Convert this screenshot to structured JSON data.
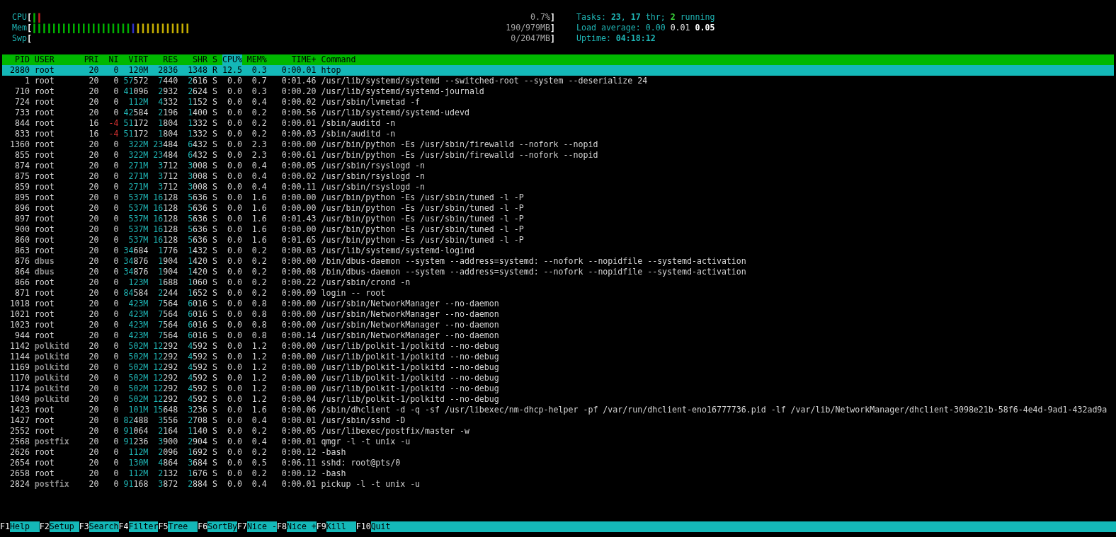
{
  "meters": [
    {
      "label": "CPU",
      "open": "[",
      "segments": [
        {
          "text": "|",
          "color": "#00b000"
        },
        {
          "text": "|",
          "color": "#c02020"
        }
      ],
      "value": "0.7%",
      "close": "]"
    },
    {
      "label": "Mem",
      "open": "[",
      "segments": [
        {
          "text": "||||||||||||||||||||",
          "color": "#00b000"
        },
        {
          "text": "|",
          "color": "#3030c8"
        },
        {
          "text": "|||||||||||",
          "color": "#c8b000"
        }
      ],
      "value": "190/979MB",
      "close": "]"
    },
    {
      "label": "Swp",
      "open": "[",
      "value": "0/2047MB",
      "close": "]"
    }
  ],
  "stats": [
    [
      {
        "text": "Tasks: ",
        "kind": "label"
      },
      {
        "text": "23",
        "kind": "value"
      },
      {
        "text": ", ",
        "kind": "label"
      },
      {
        "text": "17",
        "kind": "value"
      },
      {
        "text": " thr; ",
        "kind": "label"
      },
      {
        "text": "2",
        "kind": "running"
      },
      {
        "text": " running",
        "kind": "label"
      }
    ],
    [
      {
        "text": "Load average: ",
        "kind": "label"
      },
      {
        "text": "0.00",
        "kind": "plain"
      },
      {
        "text": "0.01",
        "kind": "mid"
      },
      {
        "text": "0.05",
        "kind": "strong"
      }
    ],
    [
      {
        "text": "Uptime: ",
        "kind": "label"
      },
      {
        "text": "04:18:12",
        "kind": "value"
      }
    ]
  ],
  "table": {
    "columns": [
      {
        "label": "PID",
        "sorted": false
      },
      {
        "label": "USER",
        "sorted": false
      },
      {
        "label": "PRI",
        "sorted": false
      },
      {
        "label": "NI",
        "sorted": false
      },
      {
        "label": "VIRT",
        "sorted": false
      },
      {
        "label": "RES",
        "sorted": false
      },
      {
        "label": "SHR",
        "sorted": false
      },
      {
        "label": "S",
        "sorted": false
      },
      {
        "label": "CPU%",
        "sorted": true
      },
      {
        "label": "MEM%",
        "sorted": false
      },
      {
        "label": "TIME+",
        "sorted": false
      },
      {
        "label": "Command",
        "sorted": false
      }
    ],
    "rows": [
      {
        "pid": "2880",
        "user": "root",
        "dim": false,
        "pri": "20",
        "ni": "0",
        "virt": "120M",
        "res": "2836",
        "shr": "1348",
        "s": "R",
        "cpu": "12.5",
        "mem": "0.3",
        "time": "0:00.01",
        "command": "htop",
        "selected": true
      },
      {
        "pid": "1",
        "user": "root",
        "dim": false,
        "pri": "20",
        "ni": "0",
        "virt": "57572",
        "res": "7440",
        "shr": "2616",
        "s": "S",
        "cpu": "0.0",
        "mem": "0.7",
        "time": "0:01.46",
        "command": "/usr/lib/systemd/systemd --switched-root --system --deserialize 24",
        "selected": false
      },
      {
        "pid": "710",
        "user": "root",
        "dim": false,
        "pri": "20",
        "ni": "0",
        "virt": "41096",
        "res": "2932",
        "shr": "2624",
        "s": "S",
        "cpu": "0.0",
        "mem": "0.3",
        "time": "0:00.20",
        "command": "/usr/lib/systemd/systemd-journald",
        "selected": false
      },
      {
        "pid": "724",
        "user": "root",
        "dim": false,
        "pri": "20",
        "ni": "0",
        "virt": "112M",
        "res": "4332",
        "shr": "1152",
        "s": "S",
        "cpu": "0.0",
        "mem": "0.4",
        "time": "0:00.02",
        "command": "/usr/sbin/lvmetad -f",
        "selected": false
      },
      {
        "pid": "733",
        "user": "root",
        "dim": false,
        "pri": "20",
        "ni": "0",
        "virt": "42584",
        "res": "2196",
        "shr": "1400",
        "s": "S",
        "cpu": "0.0",
        "mem": "0.2",
        "time": "0:00.56",
        "command": "/usr/lib/systemd/systemd-udevd",
        "selected": false
      },
      {
        "pid": "844",
        "user": "root",
        "dim": false,
        "pri": "16",
        "ni": "-4",
        "virt": "51172",
        "res": "1804",
        "shr": "1332",
        "s": "S",
        "cpu": "0.0",
        "mem": "0.2",
        "time": "0:00.01",
        "command": "/sbin/auditd -n",
        "selected": false
      },
      {
        "pid": "833",
        "user": "root",
        "dim": false,
        "pri": "16",
        "ni": "-4",
        "virt": "51172",
        "res": "1804",
        "shr": "1332",
        "s": "S",
        "cpu": "0.0",
        "mem": "0.2",
        "time": "0:00.03",
        "command": "/sbin/auditd -n",
        "selected": false
      },
      {
        "pid": "1360",
        "user": "root",
        "dim": false,
        "pri": "20",
        "ni": "0",
        "virt": "322M",
        "res": "23484",
        "shr": "6432",
        "s": "S",
        "cpu": "0.0",
        "mem": "2.3",
        "time": "0:00.00",
        "command": "/usr/bin/python -Es /usr/sbin/firewalld --nofork --nopid",
        "selected": false
      },
      {
        "pid": "855",
        "user": "root",
        "dim": false,
        "pri": "20",
        "ni": "0",
        "virt": "322M",
        "res": "23484",
        "shr": "6432",
        "s": "S",
        "cpu": "0.0",
        "mem": "2.3",
        "time": "0:00.61",
        "command": "/usr/bin/python -Es /usr/sbin/firewalld --nofork --nopid",
        "selected": false
      },
      {
        "pid": "874",
        "user": "root",
        "dim": false,
        "pri": "20",
        "ni": "0",
        "virt": "271M",
        "res": "3712",
        "shr": "3008",
        "s": "S",
        "cpu": "0.0",
        "mem": "0.4",
        "time": "0:00.05",
        "command": "/usr/sbin/rsyslogd -n",
        "selected": false
      },
      {
        "pid": "875",
        "user": "root",
        "dim": false,
        "pri": "20",
        "ni": "0",
        "virt": "271M",
        "res": "3712",
        "shr": "3008",
        "s": "S",
        "cpu": "0.0",
        "mem": "0.4",
        "time": "0:00.02",
        "command": "/usr/sbin/rsyslogd -n",
        "selected": false
      },
      {
        "pid": "859",
        "user": "root",
        "dim": false,
        "pri": "20",
        "ni": "0",
        "virt": "271M",
        "res": "3712",
        "shr": "3008",
        "s": "S",
        "cpu": "0.0",
        "mem": "0.4",
        "time": "0:00.11",
        "command": "/usr/sbin/rsyslogd -n",
        "selected": false
      },
      {
        "pid": "895",
        "user": "root",
        "dim": false,
        "pri": "20",
        "ni": "0",
        "virt": "537M",
        "res": "16128",
        "shr": "5636",
        "s": "S",
        "cpu": "0.0",
        "mem": "1.6",
        "time": "0:00.00",
        "command": "/usr/bin/python -Es /usr/sbin/tuned -l -P",
        "selected": false
      },
      {
        "pid": "896",
        "user": "root",
        "dim": false,
        "pri": "20",
        "ni": "0",
        "virt": "537M",
        "res": "16128",
        "shr": "5636",
        "s": "S",
        "cpu": "0.0",
        "mem": "1.6",
        "time": "0:00.00",
        "command": "/usr/bin/python -Es /usr/sbin/tuned -l -P",
        "selected": false
      },
      {
        "pid": "897",
        "user": "root",
        "dim": false,
        "pri": "20",
        "ni": "0",
        "virt": "537M",
        "res": "16128",
        "shr": "5636",
        "s": "S",
        "cpu": "0.0",
        "mem": "1.6",
        "time": "0:01.43",
        "command": "/usr/bin/python -Es /usr/sbin/tuned -l -P",
        "selected": false
      },
      {
        "pid": "900",
        "user": "root",
        "dim": false,
        "pri": "20",
        "ni": "0",
        "virt": "537M",
        "res": "16128",
        "shr": "5636",
        "s": "S",
        "cpu": "0.0",
        "mem": "1.6",
        "time": "0:00.00",
        "command": "/usr/bin/python -Es /usr/sbin/tuned -l -P",
        "selected": false
      },
      {
        "pid": "860",
        "user": "root",
        "dim": false,
        "pri": "20",
        "ni": "0",
        "virt": "537M",
        "res": "16128",
        "shr": "5636",
        "s": "S",
        "cpu": "0.0",
        "mem": "1.6",
        "time": "0:01.65",
        "command": "/usr/bin/python -Es /usr/sbin/tuned -l -P",
        "selected": false
      },
      {
        "pid": "863",
        "user": "root",
        "dim": false,
        "pri": "20",
        "ni": "0",
        "virt": "34684",
        "res": "1776",
        "shr": "1432",
        "s": "S",
        "cpu": "0.0",
        "mem": "0.2",
        "time": "0:00.03",
        "command": "/usr/lib/systemd/systemd-logind",
        "selected": false
      },
      {
        "pid": "876",
        "user": "dbus",
        "dim": true,
        "pri": "20",
        "ni": "0",
        "virt": "34876",
        "res": "1904",
        "shr": "1420",
        "s": "S",
        "cpu": "0.0",
        "mem": "0.2",
        "time": "0:00.00",
        "command": "/bin/dbus-daemon --system --address=systemd: --nofork --nopidfile --systemd-activation",
        "selected": false
      },
      {
        "pid": "864",
        "user": "dbus",
        "dim": true,
        "pri": "20",
        "ni": "0",
        "virt": "34876",
        "res": "1904",
        "shr": "1420",
        "s": "S",
        "cpu": "0.0",
        "mem": "0.2",
        "time": "0:00.08",
        "command": "/bin/dbus-daemon --system --address=systemd: --nofork --nopidfile --systemd-activation",
        "selected": false
      },
      {
        "pid": "866",
        "user": "root",
        "dim": false,
        "pri": "20",
        "ni": "0",
        "virt": "123M",
        "res": "1688",
        "shr": "1060",
        "s": "S",
        "cpu": "0.0",
        "mem": "0.2",
        "time": "0:00.22",
        "command": "/usr/sbin/crond -n",
        "selected": false
      },
      {
        "pid": "871",
        "user": "root",
        "dim": false,
        "pri": "20",
        "ni": "0",
        "virt": "84584",
        "res": "2244",
        "shr": "1652",
        "s": "S",
        "cpu": "0.0",
        "mem": "0.2",
        "time": "0:00.09",
        "command": "login -- root",
        "selected": false
      },
      {
        "pid": "1018",
        "user": "root",
        "dim": false,
        "pri": "20",
        "ni": "0",
        "virt": "423M",
        "res": "7564",
        "shr": "6016",
        "s": "S",
        "cpu": "0.0",
        "mem": "0.8",
        "time": "0:00.00",
        "command": "/usr/sbin/NetworkManager --no-daemon",
        "selected": false
      },
      {
        "pid": "1021",
        "user": "root",
        "dim": false,
        "pri": "20",
        "ni": "0",
        "virt": "423M",
        "res": "7564",
        "shr": "6016",
        "s": "S",
        "cpu": "0.0",
        "mem": "0.8",
        "time": "0:00.00",
        "command": "/usr/sbin/NetworkManager --no-daemon",
        "selected": false
      },
      {
        "pid": "1023",
        "user": "root",
        "dim": false,
        "pri": "20",
        "ni": "0",
        "virt": "423M",
        "res": "7564",
        "shr": "6016",
        "s": "S",
        "cpu": "0.0",
        "mem": "0.8",
        "time": "0:00.00",
        "command": "/usr/sbin/NetworkManager --no-daemon",
        "selected": false
      },
      {
        "pid": "944",
        "user": "root",
        "dim": false,
        "pri": "20",
        "ni": "0",
        "virt": "423M",
        "res": "7564",
        "shr": "6016",
        "s": "S",
        "cpu": "0.0",
        "mem": "0.8",
        "time": "0:00.14",
        "command": "/usr/sbin/NetworkManager --no-daemon",
        "selected": false
      },
      {
        "pid": "1142",
        "user": "polkitd",
        "dim": true,
        "pri": "20",
        "ni": "0",
        "virt": "502M",
        "res": "12292",
        "shr": "4592",
        "s": "S",
        "cpu": "0.0",
        "mem": "1.2",
        "time": "0:00.00",
        "command": "/usr/lib/polkit-1/polkitd --no-debug",
        "selected": false
      },
      {
        "pid": "1144",
        "user": "polkitd",
        "dim": true,
        "pri": "20",
        "ni": "0",
        "virt": "502M",
        "res": "12292",
        "shr": "4592",
        "s": "S",
        "cpu": "0.0",
        "mem": "1.2",
        "time": "0:00.00",
        "command": "/usr/lib/polkit-1/polkitd --no-debug",
        "selected": false
      },
      {
        "pid": "1169",
        "user": "polkitd",
        "dim": true,
        "pri": "20",
        "ni": "0",
        "virt": "502M",
        "res": "12292",
        "shr": "4592",
        "s": "S",
        "cpu": "0.0",
        "mem": "1.2",
        "time": "0:00.00",
        "command": "/usr/lib/polkit-1/polkitd --no-debug",
        "selected": false
      },
      {
        "pid": "1170",
        "user": "polkitd",
        "dim": true,
        "pri": "20",
        "ni": "0",
        "virt": "502M",
        "res": "12292",
        "shr": "4592",
        "s": "S",
        "cpu": "0.0",
        "mem": "1.2",
        "time": "0:00.00",
        "command": "/usr/lib/polkit-1/polkitd --no-debug",
        "selected": false
      },
      {
        "pid": "1174",
        "user": "polkitd",
        "dim": true,
        "pri": "20",
        "ni": "0",
        "virt": "502M",
        "res": "12292",
        "shr": "4592",
        "s": "S",
        "cpu": "0.0",
        "mem": "1.2",
        "time": "0:00.00",
        "command": "/usr/lib/polkit-1/polkitd --no-debug",
        "selected": false
      },
      {
        "pid": "1049",
        "user": "polkitd",
        "dim": true,
        "pri": "20",
        "ni": "0",
        "virt": "502M",
        "res": "12292",
        "shr": "4592",
        "s": "S",
        "cpu": "0.0",
        "mem": "1.2",
        "time": "0:00.04",
        "command": "/usr/lib/polkit-1/polkitd --no-debug",
        "selected": false
      },
      {
        "pid": "1423",
        "user": "root",
        "dim": false,
        "pri": "20",
        "ni": "0",
        "virt": "101M",
        "res": "15648",
        "shr": "3236",
        "s": "S",
        "cpu": "0.0",
        "mem": "1.6",
        "time": "0:00.06",
        "command": "/sbin/dhclient -d -q -sf /usr/libexec/nm-dhcp-helper -pf /var/run/dhclient-eno16777736.pid -lf /var/lib/NetworkManager/dhclient-3098e21b-58f6-4e4d-9ad1-432ad9a",
        "selected": false
      },
      {
        "pid": "1427",
        "user": "root",
        "dim": false,
        "pri": "20",
        "ni": "0",
        "virt": "82488",
        "res": "3556",
        "shr": "2708",
        "s": "S",
        "cpu": "0.0",
        "mem": "0.4",
        "time": "0:00.01",
        "command": "/usr/sbin/sshd -D",
        "selected": false
      },
      {
        "pid": "2552",
        "user": "root",
        "dim": false,
        "pri": "20",
        "ni": "0",
        "virt": "91064",
        "res": "2164",
        "shr": "1140",
        "s": "S",
        "cpu": "0.0",
        "mem": "0.2",
        "time": "0:00.05",
        "command": "/usr/libexec/postfix/master -w",
        "selected": false
      },
      {
        "pid": "2568",
        "user": "postfix",
        "dim": true,
        "pri": "20",
        "ni": "0",
        "virt": "91236",
        "res": "3900",
        "shr": "2904",
        "s": "S",
        "cpu": "0.0",
        "mem": "0.4",
        "time": "0:00.01",
        "command": "qmgr -l -t unix -u",
        "selected": false
      },
      {
        "pid": "2626",
        "user": "root",
        "dim": false,
        "pri": "20",
        "ni": "0",
        "virt": "112M",
        "res": "2096",
        "shr": "1692",
        "s": "S",
        "cpu": "0.0",
        "mem": "0.2",
        "time": "0:00.12",
        "command": "-bash",
        "selected": false
      },
      {
        "pid": "2654",
        "user": "root",
        "dim": false,
        "pri": "20",
        "ni": "0",
        "virt": "130M",
        "res": "4864",
        "shr": "3684",
        "s": "S",
        "cpu": "0.0",
        "mem": "0.5",
        "time": "0:06.11",
        "command": "sshd: root@pts/0",
        "selected": false
      },
      {
        "pid": "2658",
        "user": "root",
        "dim": false,
        "pri": "20",
        "ni": "0",
        "virt": "112M",
        "res": "2132",
        "shr": "1676",
        "s": "S",
        "cpu": "0.0",
        "mem": "0.2",
        "time": "0:00.12",
        "command": "-bash",
        "selected": false
      },
      {
        "pid": "2824",
        "user": "postfix",
        "dim": true,
        "pri": "20",
        "ni": "0",
        "virt": "91168",
        "res": "3872",
        "shr": "2884",
        "s": "S",
        "cpu": "0.0",
        "mem": "0.4",
        "time": "0:00.01",
        "command": "pickup -l -t unix -u",
        "selected": false
      }
    ]
  },
  "function_keys": [
    {
      "key": "F1",
      "label": "Help"
    },
    {
      "key": "F2",
      "label": "Setup"
    },
    {
      "key": "F3",
      "label": "Search"
    },
    {
      "key": "F4",
      "label": "Filter"
    },
    {
      "key": "F5",
      "label": "Tree"
    },
    {
      "key": "F6",
      "label": "SortBy"
    },
    {
      "key": "F7",
      "label": "Nice -"
    },
    {
      "key": "F8",
      "label": "Nice +"
    },
    {
      "key": "F9",
      "label": "Kill"
    },
    {
      "key": "F10",
      "label": "Quit"
    }
  ]
}
